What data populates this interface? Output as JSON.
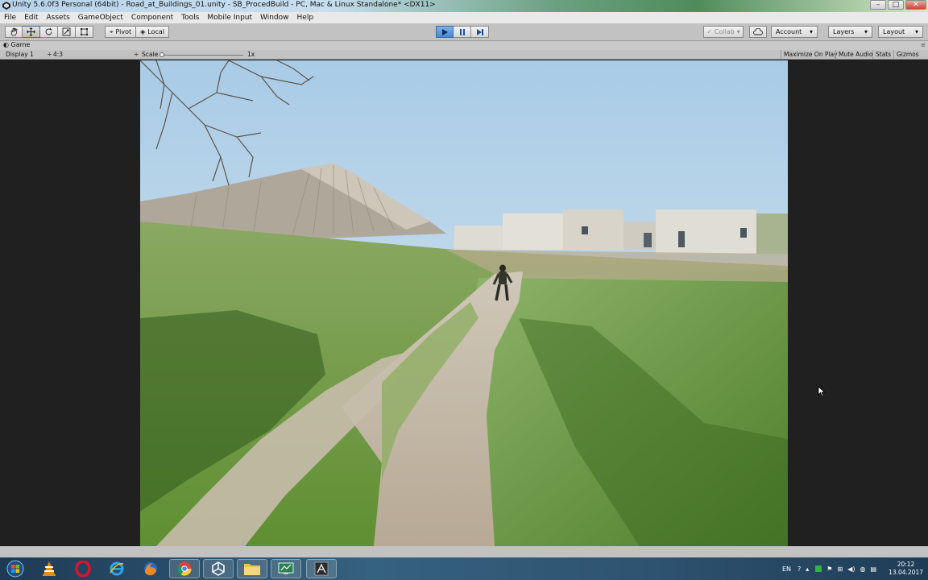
{
  "window": {
    "title": "Unity 5.6.0f3 Personal (64bit) - Road_at_Buildings_01.unity - SB_ProcedBuild - PC, Mac & Linux Standalone* <DX11>",
    "minimize": "–",
    "maximize": "□",
    "close": "✕"
  },
  "menu": [
    "File",
    "Edit",
    "Assets",
    "GameObject",
    "Component",
    "Tools",
    "Mobile Input",
    "Window",
    "Help"
  ],
  "toolbar": {
    "pivot_label": "Pivot",
    "local_label": "Local",
    "collab_label": "Collab",
    "account_label": "Account",
    "layers_label": "Layers",
    "layout_label": "Layout",
    "play_active": true
  },
  "game_view": {
    "tab_label": "Game",
    "display": "Display 1",
    "aspect": "4:3",
    "scale_label": "Scale",
    "scale_value": "1x",
    "toggles": [
      "Maximize On Play",
      "Mute Audio",
      "Stats",
      "Gizmos"
    ]
  },
  "taskbar": {
    "language": "EN",
    "time": "20:12",
    "date": "13.04.2017"
  },
  "colors": {
    "editor_gray": "#c2c2c2",
    "play_blue": "#4a86cf",
    "viewport_bg": "#202020"
  }
}
